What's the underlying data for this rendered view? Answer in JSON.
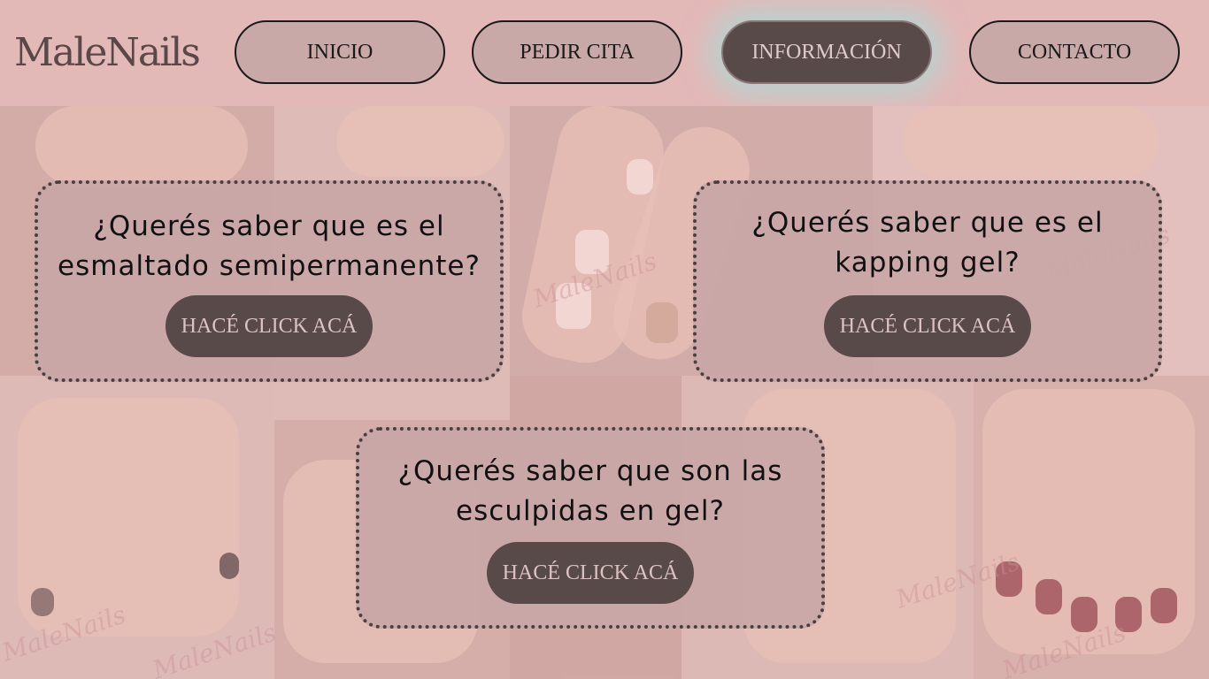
{
  "header": {
    "logo": "MaleNails",
    "nav": [
      {
        "label": "INICIO",
        "active": false
      },
      {
        "label": "PEDIR CITA",
        "active": false
      },
      {
        "label": "INFORMACIÓN",
        "active": true
      },
      {
        "label": "CONTACTO",
        "active": false
      }
    ]
  },
  "background": {
    "watermark": "MaleNails"
  },
  "cards": [
    {
      "title_line1": "¿Querés saber que es el",
      "title_line2": "esmaltado semipermanente?",
      "button": "HACÉ CLICK ACÁ"
    },
    {
      "title_line1": "¿Querés saber que es el",
      "title_line2": "kapping gel?",
      "button": "HACÉ CLICK ACÁ"
    },
    {
      "title_line1": "¿Querés saber que son las",
      "title_line2": "esculpidas en gel?",
      "button": "HACÉ CLICK ACÁ"
    }
  ],
  "colors": {
    "header_bg": "#e3b9b8",
    "nav_active_bg": "#594a4a",
    "card_bg": "#c9a7a7",
    "button_bg": "#594a4a"
  }
}
